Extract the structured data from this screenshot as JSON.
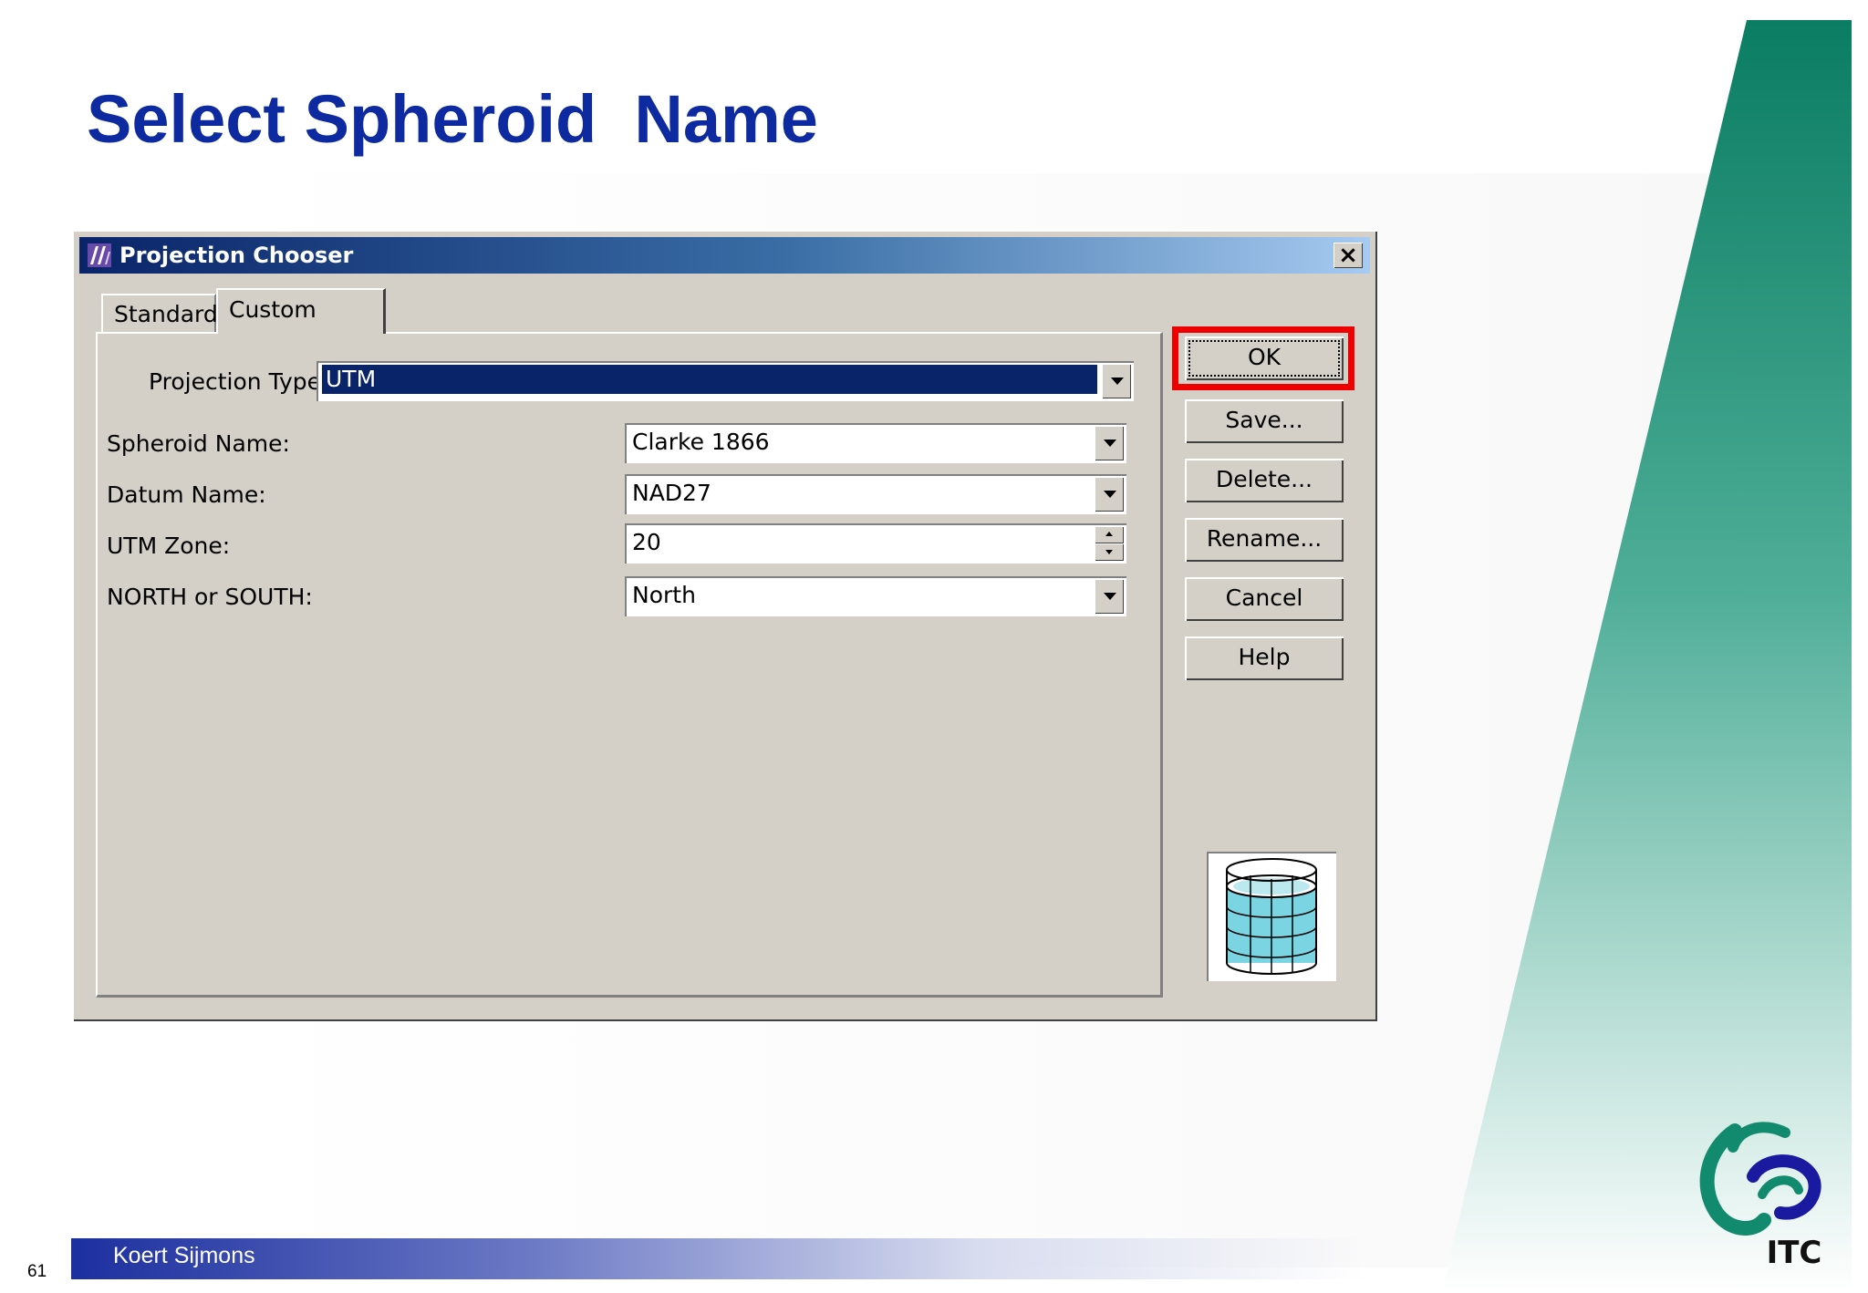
{
  "slide": {
    "title": "Select Spheroid  Name",
    "author": "Koert Sijmons",
    "page_number": "61",
    "logo_text": "ITC"
  },
  "dialog": {
    "title": "Projection Chooser",
    "close_label": "×",
    "tabs": [
      {
        "label": "Standard",
        "active": false
      },
      {
        "label": "Custom",
        "active": true
      }
    ],
    "fields": {
      "projection_type": {
        "label": "Projection Type :",
        "value": "UTM"
      },
      "spheroid_name": {
        "label": "Spheroid Name:",
        "value": "Clarke 1866"
      },
      "datum_name": {
        "label": "Datum Name:",
        "value": "NAD27"
      },
      "utm_zone": {
        "label": "UTM Zone:",
        "value": "20"
      },
      "north_south": {
        "label": "NORTH or SOUTH:",
        "value": "North"
      }
    },
    "buttons": {
      "ok": "OK",
      "save": "Save...",
      "delete": "Delete...",
      "rename": "Rename...",
      "cancel": "Cancel",
      "help": "Help"
    }
  },
  "colors": {
    "title": "#0d2aa0",
    "highlight": "#ee0000",
    "selection": "#0a246a",
    "teal": "#128a6e"
  },
  "icons": {
    "app_icon": "projection-app-icon",
    "preview": "cylinder-projection-icon",
    "logo": "itc-logo"
  }
}
